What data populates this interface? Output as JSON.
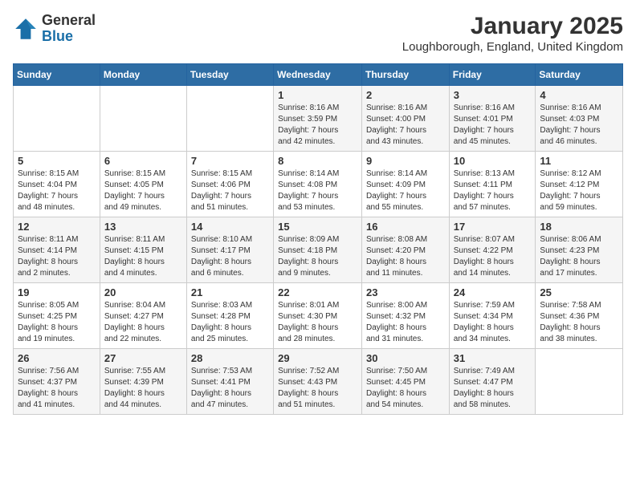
{
  "logo": {
    "general": "General",
    "blue": "Blue"
  },
  "title": "January 2025",
  "location": "Loughborough, England, United Kingdom",
  "days_of_week": [
    "Sunday",
    "Monday",
    "Tuesday",
    "Wednesday",
    "Thursday",
    "Friday",
    "Saturday"
  ],
  "weeks": [
    [
      {
        "day": "",
        "info": ""
      },
      {
        "day": "",
        "info": ""
      },
      {
        "day": "",
        "info": ""
      },
      {
        "day": "1",
        "info": "Sunrise: 8:16 AM\nSunset: 3:59 PM\nDaylight: 7 hours\nand 42 minutes."
      },
      {
        "day": "2",
        "info": "Sunrise: 8:16 AM\nSunset: 4:00 PM\nDaylight: 7 hours\nand 43 minutes."
      },
      {
        "day": "3",
        "info": "Sunrise: 8:16 AM\nSunset: 4:01 PM\nDaylight: 7 hours\nand 45 minutes."
      },
      {
        "day": "4",
        "info": "Sunrise: 8:16 AM\nSunset: 4:03 PM\nDaylight: 7 hours\nand 46 minutes."
      }
    ],
    [
      {
        "day": "5",
        "info": "Sunrise: 8:15 AM\nSunset: 4:04 PM\nDaylight: 7 hours\nand 48 minutes."
      },
      {
        "day": "6",
        "info": "Sunrise: 8:15 AM\nSunset: 4:05 PM\nDaylight: 7 hours\nand 49 minutes."
      },
      {
        "day": "7",
        "info": "Sunrise: 8:15 AM\nSunset: 4:06 PM\nDaylight: 7 hours\nand 51 minutes."
      },
      {
        "day": "8",
        "info": "Sunrise: 8:14 AM\nSunset: 4:08 PM\nDaylight: 7 hours\nand 53 minutes."
      },
      {
        "day": "9",
        "info": "Sunrise: 8:14 AM\nSunset: 4:09 PM\nDaylight: 7 hours\nand 55 minutes."
      },
      {
        "day": "10",
        "info": "Sunrise: 8:13 AM\nSunset: 4:11 PM\nDaylight: 7 hours\nand 57 minutes."
      },
      {
        "day": "11",
        "info": "Sunrise: 8:12 AM\nSunset: 4:12 PM\nDaylight: 7 hours\nand 59 minutes."
      }
    ],
    [
      {
        "day": "12",
        "info": "Sunrise: 8:11 AM\nSunset: 4:14 PM\nDaylight: 8 hours\nand 2 minutes."
      },
      {
        "day": "13",
        "info": "Sunrise: 8:11 AM\nSunset: 4:15 PM\nDaylight: 8 hours\nand 4 minutes."
      },
      {
        "day": "14",
        "info": "Sunrise: 8:10 AM\nSunset: 4:17 PM\nDaylight: 8 hours\nand 6 minutes."
      },
      {
        "day": "15",
        "info": "Sunrise: 8:09 AM\nSunset: 4:18 PM\nDaylight: 8 hours\nand 9 minutes."
      },
      {
        "day": "16",
        "info": "Sunrise: 8:08 AM\nSunset: 4:20 PM\nDaylight: 8 hours\nand 11 minutes."
      },
      {
        "day": "17",
        "info": "Sunrise: 8:07 AM\nSunset: 4:22 PM\nDaylight: 8 hours\nand 14 minutes."
      },
      {
        "day": "18",
        "info": "Sunrise: 8:06 AM\nSunset: 4:23 PM\nDaylight: 8 hours\nand 17 minutes."
      }
    ],
    [
      {
        "day": "19",
        "info": "Sunrise: 8:05 AM\nSunset: 4:25 PM\nDaylight: 8 hours\nand 19 minutes."
      },
      {
        "day": "20",
        "info": "Sunrise: 8:04 AM\nSunset: 4:27 PM\nDaylight: 8 hours\nand 22 minutes."
      },
      {
        "day": "21",
        "info": "Sunrise: 8:03 AM\nSunset: 4:28 PM\nDaylight: 8 hours\nand 25 minutes."
      },
      {
        "day": "22",
        "info": "Sunrise: 8:01 AM\nSunset: 4:30 PM\nDaylight: 8 hours\nand 28 minutes."
      },
      {
        "day": "23",
        "info": "Sunrise: 8:00 AM\nSunset: 4:32 PM\nDaylight: 8 hours\nand 31 minutes."
      },
      {
        "day": "24",
        "info": "Sunrise: 7:59 AM\nSunset: 4:34 PM\nDaylight: 8 hours\nand 34 minutes."
      },
      {
        "day": "25",
        "info": "Sunrise: 7:58 AM\nSunset: 4:36 PM\nDaylight: 8 hours\nand 38 minutes."
      }
    ],
    [
      {
        "day": "26",
        "info": "Sunrise: 7:56 AM\nSunset: 4:37 PM\nDaylight: 8 hours\nand 41 minutes."
      },
      {
        "day": "27",
        "info": "Sunrise: 7:55 AM\nSunset: 4:39 PM\nDaylight: 8 hours\nand 44 minutes."
      },
      {
        "day": "28",
        "info": "Sunrise: 7:53 AM\nSunset: 4:41 PM\nDaylight: 8 hours\nand 47 minutes."
      },
      {
        "day": "29",
        "info": "Sunrise: 7:52 AM\nSunset: 4:43 PM\nDaylight: 8 hours\nand 51 minutes."
      },
      {
        "day": "30",
        "info": "Sunrise: 7:50 AM\nSunset: 4:45 PM\nDaylight: 8 hours\nand 54 minutes."
      },
      {
        "day": "31",
        "info": "Sunrise: 7:49 AM\nSunset: 4:47 PM\nDaylight: 8 hours\nand 58 minutes."
      },
      {
        "day": "",
        "info": ""
      }
    ]
  ]
}
